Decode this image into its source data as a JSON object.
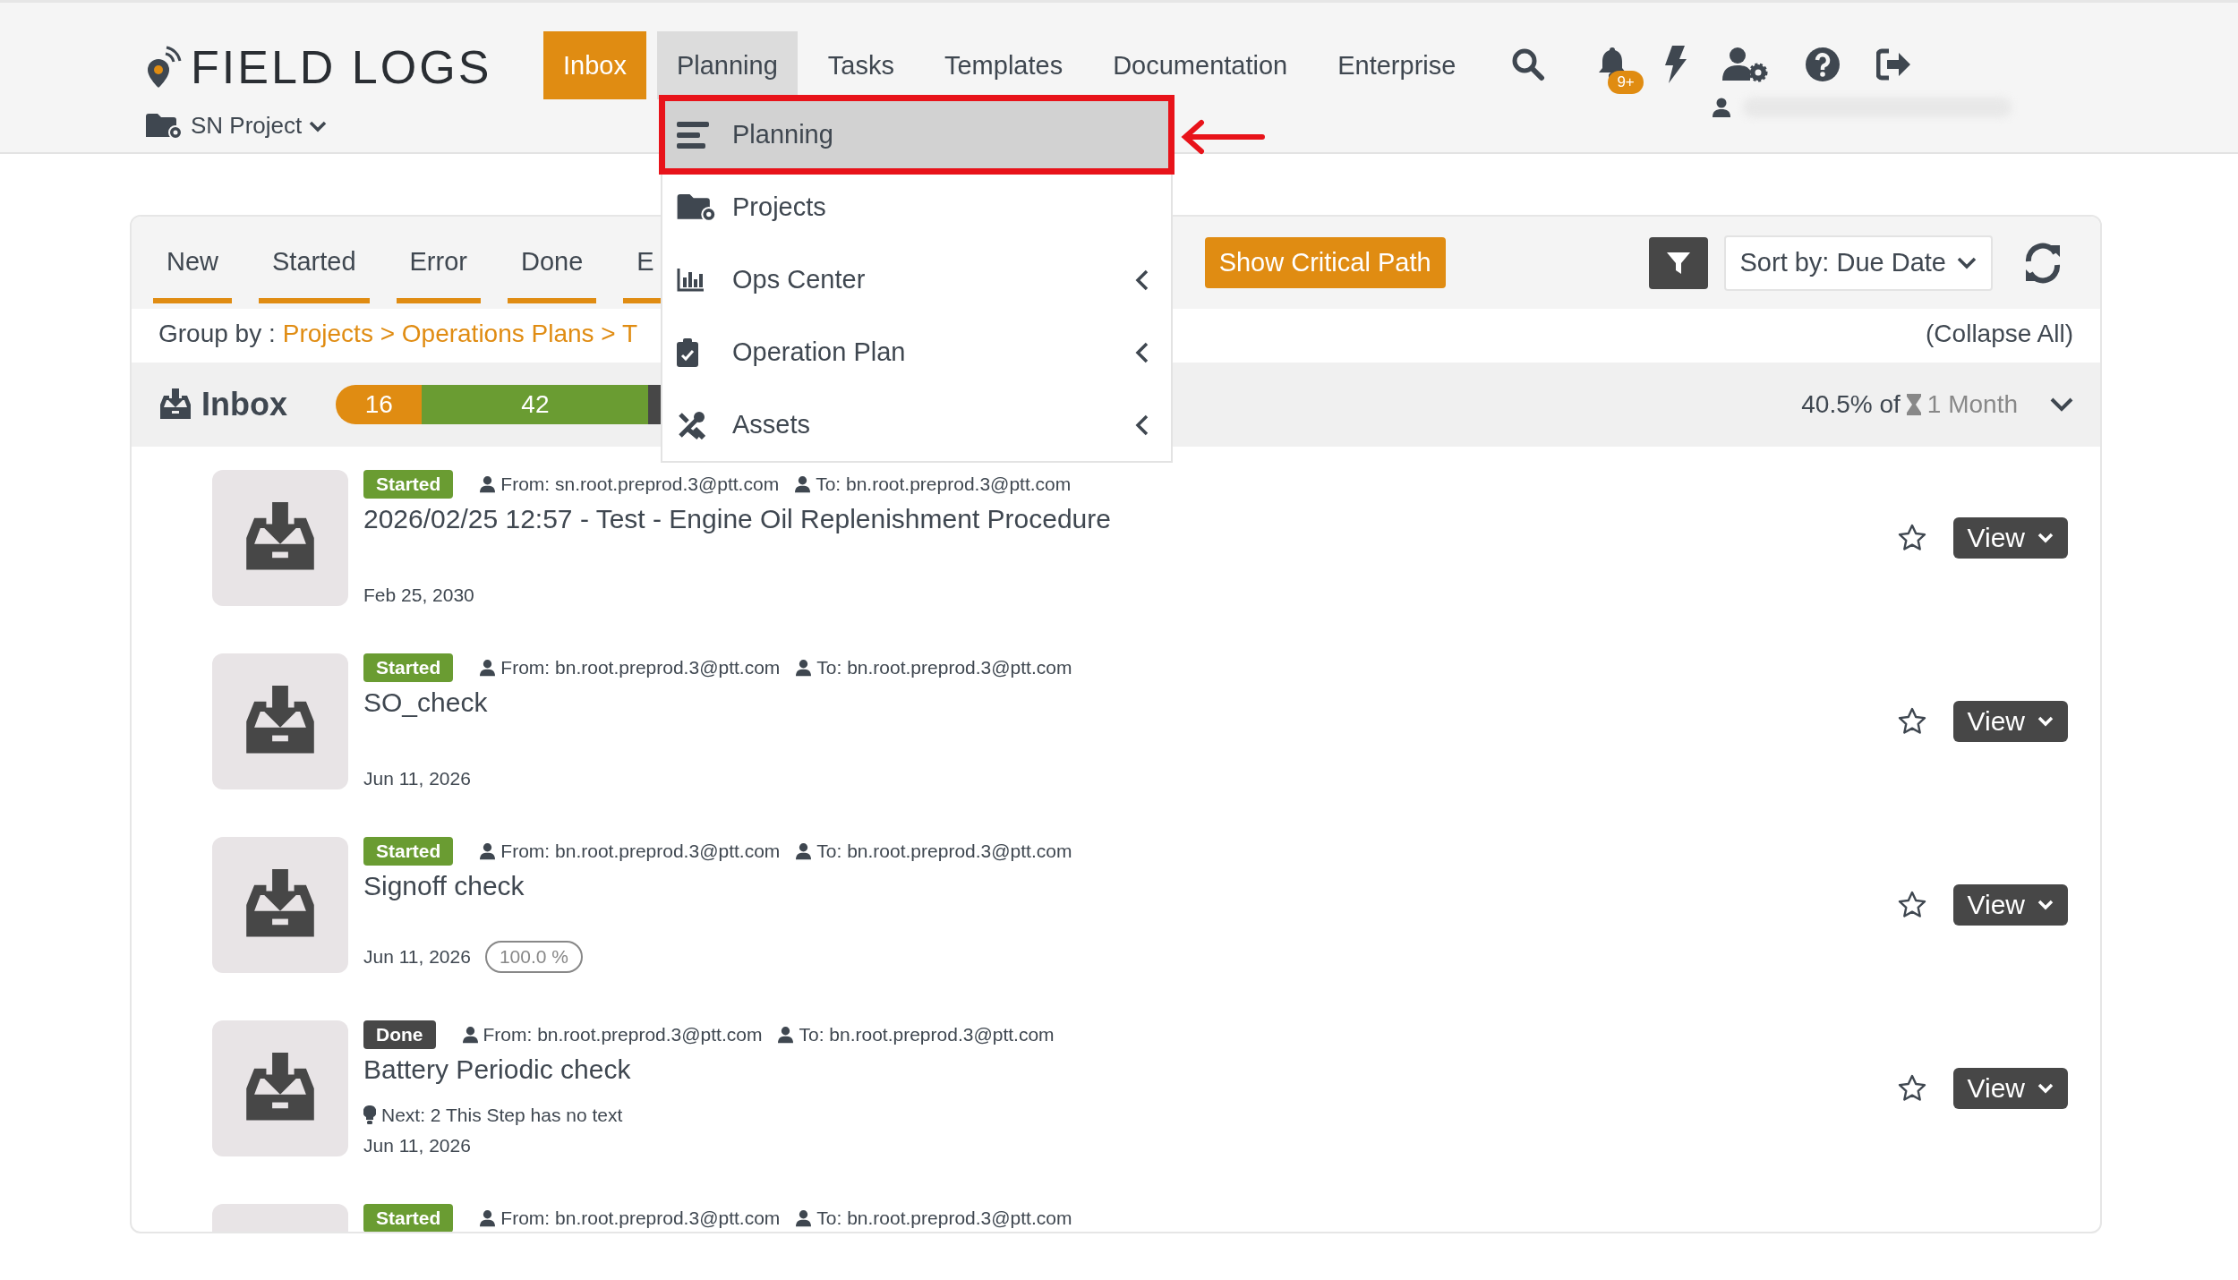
{
  "app": {
    "logo": "FIELD LOGS",
    "project": "SN Project",
    "notifications": "9+"
  },
  "nav": [
    {
      "label": "Inbox",
      "selected": true,
      "expanded": false
    },
    {
      "label": "Planning",
      "selected": false,
      "expanded": true
    },
    {
      "label": "Tasks",
      "selected": false,
      "expanded": false
    },
    {
      "label": "Templates",
      "selected": false,
      "expanded": false
    },
    {
      "label": "Documentation",
      "selected": false,
      "expanded": false
    },
    {
      "label": "Enterprise",
      "selected": false,
      "expanded": false
    }
  ],
  "planning_menu": [
    {
      "label": "Planning",
      "selected": true,
      "submenu": false
    },
    {
      "label": "Projects",
      "selected": false,
      "submenu": false
    },
    {
      "label": "Ops Center",
      "selected": false,
      "submenu": true
    },
    {
      "label": "Operation Plan",
      "selected": false,
      "submenu": true
    },
    {
      "label": "Assets",
      "selected": false,
      "submenu": true
    }
  ],
  "filter_tabs": [
    "New",
    "Started",
    "Error",
    "Done",
    "E"
  ],
  "critical_path_button": "Show Critical Path",
  "sort": "Sort by: Due Date",
  "group_by": {
    "label": "Group by :",
    "path": "Projects > Operations Plans > T",
    "collapse": "(Collapse All)"
  },
  "group": {
    "title": "Inbox",
    "segments": [
      {
        "label": "16",
        "color": "#e08c12"
      },
      {
        "label": "42",
        "color": "#6a9c32"
      },
      {
        "color": "#474747"
      }
    ],
    "share": "40.5% of",
    "period": "1 Month"
  },
  "items": [
    {
      "status": "Started",
      "kind": "started",
      "from": "From: sn.root.preprod.3@ptt.com",
      "to": "To: bn.root.preprod.3@ptt.com",
      "title": "2026/02/25 12:57 - Test - Engine Oil Replenishment Procedure",
      "date": "Feb 25, 2030",
      "starred": false,
      "view": "View"
    },
    {
      "status": "Started",
      "kind": "started",
      "from": "From: bn.root.preprod.3@ptt.com",
      "to": "To: bn.root.preprod.3@ptt.com",
      "title": "SO_check",
      "date": "Jun 11, 2026",
      "starred": false,
      "view": "View"
    },
    {
      "status": "Started",
      "kind": "started",
      "from": "From: bn.root.preprod.3@ptt.com",
      "to": "To: bn.root.preprod.3@ptt.com",
      "title": "Signoff check",
      "date": "Jun 11, 2026",
      "progress": "100.0 %",
      "starred": false,
      "view": "View"
    },
    {
      "status": "Done",
      "kind": "done",
      "from": "From: bn.root.preprod.3@ptt.com",
      "to": "To: bn.root.preprod.3@ptt.com",
      "title": "Battery Periodic check",
      "next": {
        "label": "Next:",
        "number": "2",
        "text": "This Step has no text"
      },
      "date": "Jun 11, 2026",
      "starred": false,
      "view": "View"
    },
    {
      "status": "Started",
      "kind": "started",
      "from": "From: bn.root.preprod.3@ptt.com",
      "to": "To: bn.root.preprod.3@ptt.com"
    }
  ]
}
